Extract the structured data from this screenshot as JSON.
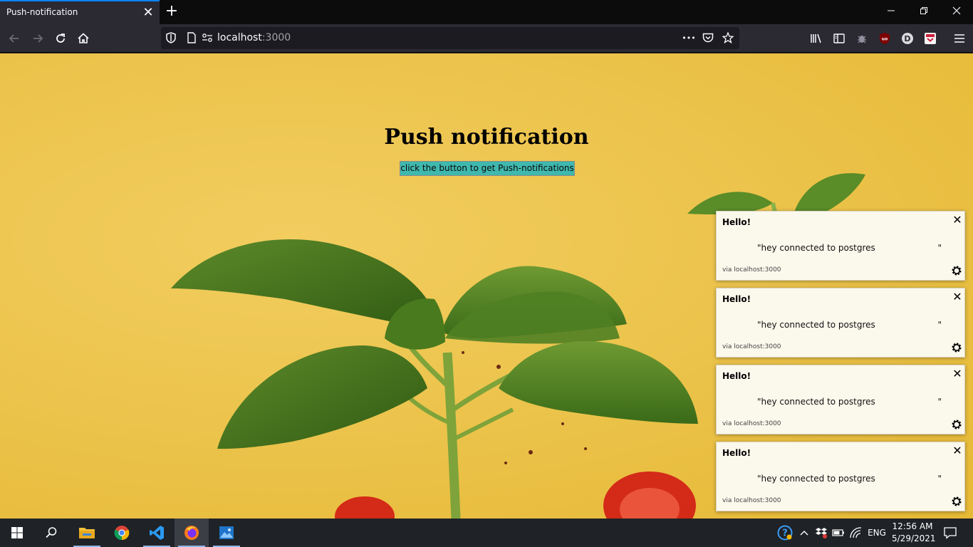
{
  "browser": {
    "tab_title": "Push-notification",
    "tab_close": "✕",
    "new_tab": "+",
    "url_host": "localhost",
    "url_port": ":3000",
    "url_more": "•••"
  },
  "page": {
    "title": "Push notification",
    "button_label": "click the button to get Push-notifications"
  },
  "notifications": [
    {
      "title": "Hello!",
      "body": "\"hey connected to postgres                       \"",
      "via": "via localhost:3000",
      "close": "✕"
    },
    {
      "title": "Hello!",
      "body": "\"hey connected to postgres                       \"",
      "via": "via localhost:3000",
      "close": "✕"
    },
    {
      "title": "Hello!",
      "body": "\"hey connected to postgres                       \"",
      "via": "via localhost:3000",
      "close": "✕"
    },
    {
      "title": "Hello!",
      "body": "\"hey connected to postgres                       \"",
      "via": "via localhost:3000",
      "close": "✕"
    }
  ],
  "taskbar": {
    "language": "ENG",
    "time": "12:56 AM",
    "date": "5/29/2021"
  },
  "icons": {
    "back": "back-arrow-icon",
    "forward": "forward-arrow-icon",
    "reload": "reload-icon",
    "home": "home-icon",
    "shield": "tracking-protection-icon",
    "page": "page-icon",
    "permissions": "permissions-icon",
    "pocket": "pocket-icon",
    "bookmark": "bookmark-star-icon",
    "library": "library-icon",
    "sidebar": "sidebar-icon",
    "extensions": [
      "bug-extension-icon",
      "ublock-origin-icon",
      "d-extension-icon",
      "pocket-extension-icon"
    ],
    "menu": "hamburger-menu-icon",
    "gear": "gear-icon"
  },
  "colors": {
    "tab_active_accent": "#0a84ff",
    "button_bg": "#3fb8ae",
    "notification_bg": "#fbf8ec",
    "page_bg": "#ecc44d"
  }
}
